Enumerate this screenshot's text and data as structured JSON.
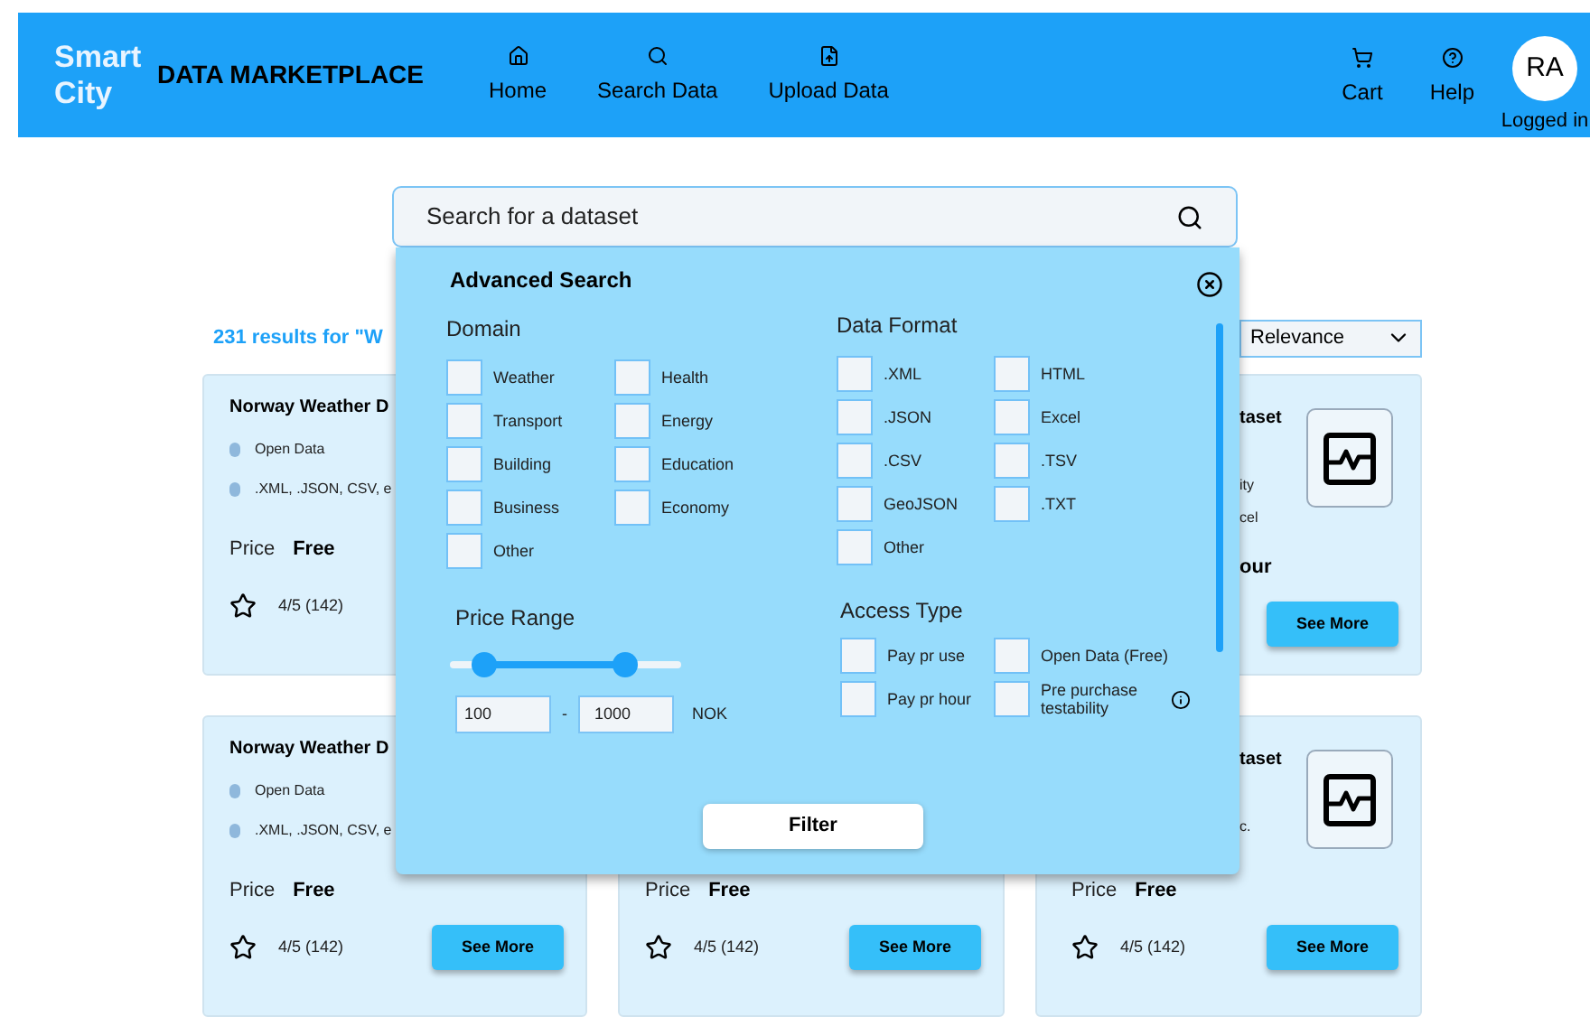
{
  "header": {
    "logo": "Smart City",
    "title": "DATA MARKETPLACE",
    "nav": [
      {
        "label": "Home"
      },
      {
        "label": "Search Data"
      },
      {
        "label": "Upload Data"
      }
    ],
    "actions": [
      {
        "label": "Cart"
      },
      {
        "label": "Help"
      }
    ],
    "user": {
      "initials": "RA",
      "label": "Logged in"
    }
  },
  "search": {
    "placeholder": "Search for a dataset"
  },
  "results_summary": "231 results for \"W",
  "sort": {
    "value": "Relevance"
  },
  "cards": [
    {
      "kind": "left",
      "title": "Norway Weather D",
      "tags": [
        "Open Data",
        ".XML, .JSON, CSV, e"
      ],
      "price_label": "Price",
      "price": "Free",
      "rating": "4/5 (142)"
    },
    {
      "kind": "right",
      "title": "taset",
      "tags": [
        "ity",
        "cel"
      ],
      "price": "our",
      "button": "See More"
    },
    {
      "kind": "left",
      "title": "Norway Weather D",
      "tags": [
        "Open Data",
        ".XML, .JSON, CSV, e"
      ],
      "price_label": "Price",
      "price": "Free",
      "rating": "4/5 (142)",
      "button": "See More"
    },
    {
      "kind": "middle",
      "price_label": "Price",
      "price": "Free",
      "rating": "4/5 (142)",
      "button": "See More"
    },
    {
      "kind": "right",
      "title": "taset",
      "tags": [
        "c."
      ],
      "price_label": "Price",
      "price": "Free",
      "rating": "4/5 (142)",
      "button": "See More"
    }
  ],
  "advanced_search": {
    "title": "Advanced Search",
    "domain": {
      "label": "Domain",
      "options": [
        {
          "label": "Weather",
          "checked": false
        },
        {
          "label": "Health",
          "checked": false
        },
        {
          "label": "Transport",
          "checked": false
        },
        {
          "label": "Energy",
          "checked": false
        },
        {
          "label": "Building",
          "checked": false
        },
        {
          "label": "Education",
          "checked": false
        },
        {
          "label": "Business",
          "checked": false
        },
        {
          "label": "Economy",
          "checked": false
        },
        {
          "label": "Other",
          "checked": false
        }
      ]
    },
    "price_range": {
      "label": "Price Range",
      "thumbs": [
        {
          "level": 0.15
        },
        {
          "level": 0.76
        }
      ],
      "min": "100",
      "separator": "-",
      "max": "1000",
      "currency": "NOK"
    },
    "data_format": {
      "label": "Data Format",
      "options": [
        {
          "label": ".XML",
          "checked": false
        },
        {
          "label": "HTML",
          "checked": false
        },
        {
          "label": ".JSON",
          "checked": false
        },
        {
          "label": "Excel",
          "checked": false
        },
        {
          "label": ".CSV",
          "checked": false
        },
        {
          "label": ".TSV",
          "checked": false
        },
        {
          "label": "GeoJSON",
          "checked": false
        },
        {
          "label": ".TXT",
          "checked": false
        },
        {
          "label": "Other",
          "checked": false
        }
      ]
    },
    "access_type": {
      "label": "Access Type",
      "options": [
        {
          "label": "Pay pr use",
          "checked": false
        },
        {
          "label": "Open Data (Free)",
          "checked": false
        },
        {
          "label": "Pay pr hour",
          "checked": false
        },
        {
          "label": "Pre purchase testability",
          "checked": false,
          "info": true
        }
      ]
    },
    "button": "Filter"
  }
}
